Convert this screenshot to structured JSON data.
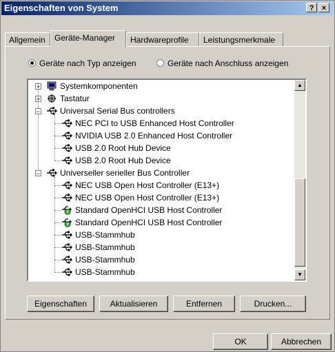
{
  "window": {
    "title": "Eigenschaften von System",
    "help_glyph": "?",
    "close_glyph": "×"
  },
  "tabs": [
    {
      "label": "Allgemein"
    },
    {
      "label": "Geräte-Manager"
    },
    {
      "label": "Hardwareprofile"
    },
    {
      "label": "Leistungsmerkmale"
    }
  ],
  "view": {
    "by_type_label": "Geräte nach Typ anzeigen",
    "by_connection_label": "Geräte nach Anschluss anzeigen",
    "selected": "by_type"
  },
  "tree": [
    {
      "label": "Systemkomponenten",
      "level": 0,
      "expand": "+",
      "icon": "computer-icon"
    },
    {
      "label": "Tastatur",
      "level": 0,
      "expand": "+",
      "icon": "keyboard-icon"
    },
    {
      "label": "Universal Serial Bus controllers",
      "level": 0,
      "expand": "-",
      "icon": "usb-icon"
    },
    {
      "label": "NEC PCI to USB Enhanced Host Controller",
      "level": 1,
      "icon": "usb-icon"
    },
    {
      "label": "NVIDIA USB 2.0 Enhanced Host Controller",
      "level": 1,
      "icon": "usb-icon"
    },
    {
      "label": "USB 2.0 Root Hub Device",
      "level": 1,
      "icon": "usb-icon"
    },
    {
      "label": "USB 2.0 Root Hub Device",
      "level": 1,
      "icon": "usb-icon"
    },
    {
      "label": "Universeller serieller Bus Controller",
      "level": 0,
      "expand": "-",
      "icon": "usb-icon"
    },
    {
      "label": "NEC USB Open Host Controller (E13+)",
      "level": 1,
      "icon": "usb-icon"
    },
    {
      "label": "NEC USB Open Host Controller (E13+)",
      "level": 1,
      "icon": "usb-icon"
    },
    {
      "label": "Standard OpenHCI USB Host Controller",
      "level": 1,
      "icon": "usb-warning-icon"
    },
    {
      "label": "Standard OpenHCI USB Host Controller",
      "level": 1,
      "icon": "usb-warning-icon"
    },
    {
      "label": "USB-Stammhub",
      "level": 1,
      "icon": "usb-icon"
    },
    {
      "label": "USB-Stammhub",
      "level": 1,
      "icon": "usb-icon"
    },
    {
      "label": "USB-Stammhub",
      "level": 1,
      "icon": "usb-icon"
    },
    {
      "label": "USB-Stammhub",
      "level": 1,
      "icon": "usb-icon"
    }
  ],
  "scrollbar": {
    "up_glyph": "▲",
    "down_glyph": "▼"
  },
  "actions": {
    "properties": "Eigenschaften",
    "refresh": "Aktualisieren",
    "remove": "Entfernen",
    "print": "Drucken..."
  },
  "dialog": {
    "ok": "OK",
    "cancel": "Abbrechen"
  },
  "colors": {
    "titlebar_start": "#0a246a",
    "titlebar_end": "#a6caf0",
    "face": "#d4d0c8",
    "warning": "#2e9a2e"
  }
}
